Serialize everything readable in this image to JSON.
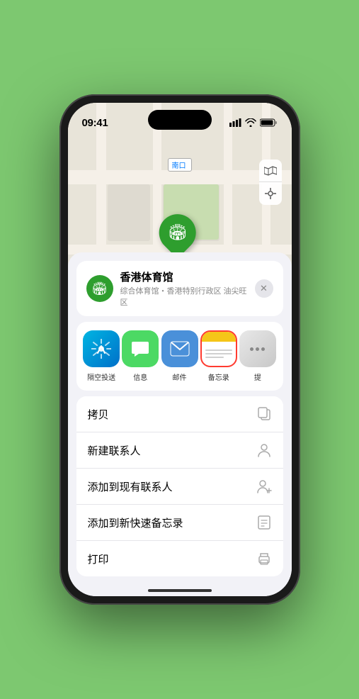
{
  "status_bar": {
    "time": "09:41",
    "signal": "▐▐▐▐",
    "wifi": "WiFi",
    "battery": "Batt"
  },
  "map": {
    "label_prefix": "南口",
    "stadium_name": "香港体育馆"
  },
  "location_card": {
    "name": "香港体育馆",
    "desc": "综合体育馆・香港特别行政区 油尖旺区",
    "close_label": "✕"
  },
  "share_items": [
    {
      "label": "隔空投送",
      "type": "airdrop"
    },
    {
      "label": "信息",
      "type": "message"
    },
    {
      "label": "邮件",
      "type": "mail"
    },
    {
      "label": "备忘录",
      "type": "notes"
    },
    {
      "label": "提",
      "type": "more"
    }
  ],
  "action_items": [
    {
      "label": "拷贝",
      "icon": "copy"
    },
    {
      "label": "新建联系人",
      "icon": "person"
    },
    {
      "label": "添加到现有联系人",
      "icon": "person-add"
    },
    {
      "label": "添加到新快速备忘录",
      "icon": "note"
    },
    {
      "label": "打印",
      "icon": "print"
    }
  ]
}
